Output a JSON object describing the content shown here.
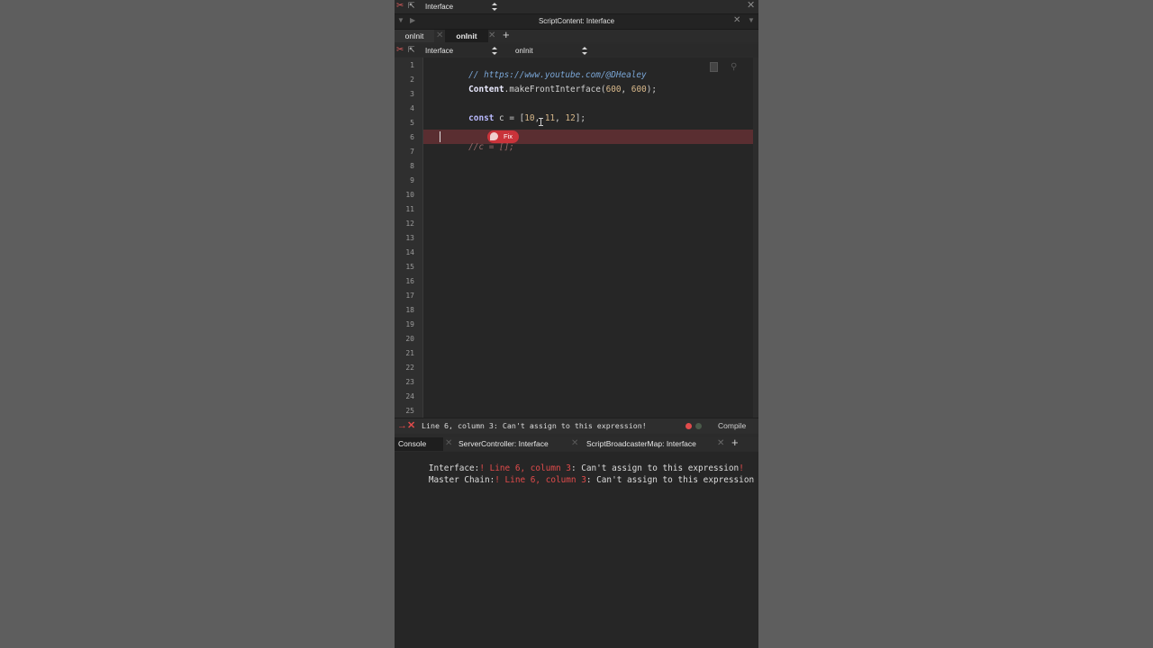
{
  "window": {
    "processor_selector": "Interface",
    "panel_title": "ScriptContent: Interface"
  },
  "editor_tabs": [
    {
      "label": "onInit"
    },
    {
      "label": "onInit"
    }
  ],
  "editor_toolbar": {
    "processor": "Interface",
    "callback": "onInit"
  },
  "code": {
    "line_numbers": [
      "1",
      "2",
      "3",
      "4",
      "5",
      "6",
      "7",
      "8",
      "9",
      "10",
      "11",
      "12",
      "13",
      "14",
      "15",
      "16",
      "17",
      "18",
      "19",
      "20",
      "21",
      "22",
      "23",
      "24",
      "25"
    ],
    "line1_comment": "// https://www.youtube.com/@DHealey",
    "line2_obj": "Content",
    "line2_method": ".makeFrontInterface(",
    "line2_a1": "600",
    "line2_sep": ", ",
    "line2_a2": "600",
    "line2_end": ");",
    "line4_kw": "const",
    "line4_var": " c = [",
    "line4_v1": "10",
    "line4_v2": "11",
    "line4_v3": "12",
    "line4_comma": ", ",
    "line4_end": "];",
    "line6_code": "//c = [];",
    "fix_label": "Fix"
  },
  "status": {
    "message": "Line 6, column 3: Can't assign to this expression!",
    "compile_label": "Compile"
  },
  "bottom_tabs": [
    {
      "label": "Console"
    },
    {
      "label": "ServerController: Interface"
    },
    {
      "label": "ScriptBroadcasterMap: Interface"
    }
  ],
  "console": {
    "line1_prefix": "Interface:",
    "line1_loc": "! Line 6, column 3",
    "line1_msg": ": Can't assign to this expression",
    "line1_suffix": "!",
    "line2_prefix": "Master Chain:",
    "line2_loc": "! Line 6, column 3",
    "line2_msg": ": Can't assign to this expression"
  },
  "colors": {
    "background": "#5e5e5e",
    "panel": "#2b2b2b",
    "error_line": "#5a2e31",
    "error_red": "#e04b4b",
    "keyword": "#bbbbff",
    "number": "#d8b88a",
    "comment": "#7aa6d6"
  }
}
